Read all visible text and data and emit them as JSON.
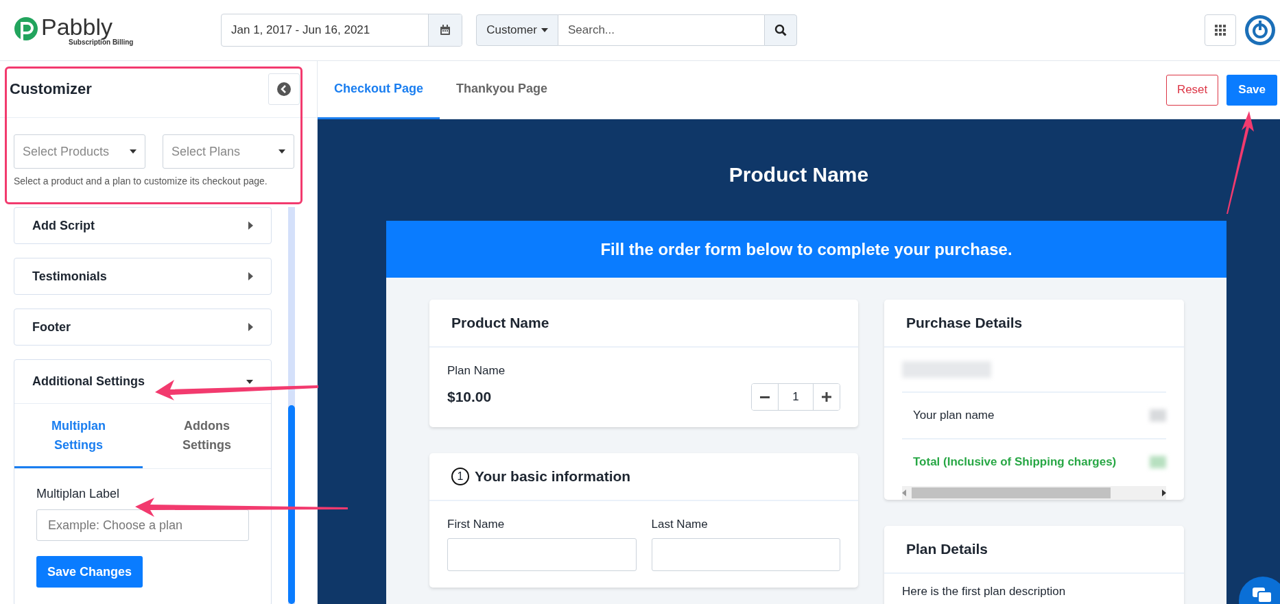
{
  "header": {
    "logo": {
      "name": "Pabbly",
      "tagline": "Subscription Billing"
    },
    "date_range": "Jan 1, 2017 - Jun 16, 2021",
    "search_scope": "Customer",
    "search": {
      "placeholder": "Search..."
    }
  },
  "customizer": {
    "title": "Customizer",
    "product_select": {
      "placeholder": "Select Products"
    },
    "plan_select": {
      "placeholder": "Select Plans"
    },
    "hint": "Select a product and a plan to customize its checkout page.",
    "sections": [
      {
        "label": "Add Script",
        "expanded": false
      },
      {
        "label": "Testimonials",
        "expanded": false
      },
      {
        "label": "Footer",
        "expanded": false
      },
      {
        "label": "Additional Settings",
        "expanded": true,
        "tabs": [
          {
            "label": "Multiplan Settings",
            "selected": true
          },
          {
            "label": "Addons Settings",
            "selected": false
          }
        ],
        "field_label": "Multiplan Label",
        "field": {
          "placeholder": "Example: Choose a plan"
        },
        "button": "Save Changes"
      }
    ]
  },
  "preview_tabs": [
    {
      "label": "Checkout Page",
      "selected": true
    },
    {
      "label": "Thankyou Page",
      "selected": false
    }
  ],
  "actions": {
    "reset": "Reset",
    "save": "Save"
  },
  "checkout": {
    "title": "Product Name",
    "banner": "Fill the order form below to complete your purchase.",
    "product_card": {
      "title": "Product Name",
      "plan": "Plan Name",
      "price": "$10.00",
      "quantity": "1"
    },
    "basic_info": {
      "step": "1",
      "title": "Your basic information",
      "fields": [
        {
          "label": "First Name"
        },
        {
          "label": "Last Name"
        }
      ]
    },
    "purchase_details": {
      "title": "Purchase Details",
      "rows": [
        {
          "kind": "item",
          "label": "Your plan name"
        },
        {
          "kind": "total",
          "label": "Total (Inclusive of Shipping charges)"
        }
      ]
    },
    "plan_details": {
      "title": "Plan Details",
      "description": "Here is the first plan description"
    }
  }
}
